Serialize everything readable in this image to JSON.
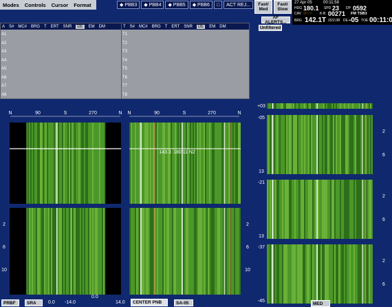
{
  "menu": [
    "Modes",
    "Controls",
    "Cursor",
    "Format"
  ],
  "pbb": [
    "PBB3",
    "PBB4",
    "PBB5",
    "PBB6"
  ],
  "pbb_extra": "ACT REJ...",
  "fast_med": "Fast/ Med",
  "fast_slow": "Fast/ Slow",
  "af_alerts": "AF ALERTS...",
  "unfiltered": "Unfiltered",
  "info": {
    "date": "27 Apr 05",
    "time1": "00:11:58",
    "hdg_label": "HDG",
    "hdg": "180.1",
    "spd_label": "SPD",
    "spd": "23",
    "dp_label": "DP",
    "dp": "0592",
    "cav_label": "CAV",
    "kb_label": "K-B",
    "kb": "00271",
    "fm": "FM TSB3",
    "brg_label": "BRG",
    "brg": "142.1T",
    "brg2": "/322.0R",
    "de_label": "DE",
    "de": "-05",
    "toe_label": "TOE",
    "toe": "00:11:02"
  },
  "table_left": {
    "headers": [
      "A",
      "S#",
      "MC#",
      "BRG",
      "T",
      "ERT",
      "SNR",
      "DE",
      "EM",
      "DM"
    ],
    "rows": [
      "A1",
      "A2",
      "A3",
      "A4",
      "A5",
      "A6",
      "A7",
      "A8"
    ]
  },
  "table_right": {
    "headers": [
      "T",
      "S#",
      "MC#",
      "BRG",
      "T",
      "ERT",
      "SNR",
      "DE",
      "EM",
      "DM"
    ],
    "rows": [
      "T1",
      "T2",
      "T3",
      "T4",
      "T5",
      "T6",
      "T7",
      "T8"
    ]
  },
  "axis_labels": [
    "N",
    "90",
    "S",
    "270",
    "N"
  ],
  "left_ticks_top": [
    "2",
    "4",
    "6",
    "8"
  ],
  "left_ticks_bot": [
    "2",
    "6",
    "10"
  ],
  "center_ticks_bot": [
    "2",
    "6",
    "10"
  ],
  "right_ticks": [
    "2",
    "6"
  ],
  "right_panel_nums": [
    "-11",
    "+03",
    "-05",
    "13",
    "-21",
    "13",
    "-37",
    "-45"
  ],
  "cursor_labels": [
    "143.3",
    "180.11 N2"
  ],
  "footer": {
    "prbf": "PRBF",
    "sra": "SRA",
    "v0": "0.0",
    "v14n": "-14.0",
    "v0b": "0.0",
    "v14": "14.0",
    "center": "CENTER PNB",
    "sa": "SA-05",
    "med": "MED"
  },
  "colors": {
    "bg": "#10286e",
    "waterfall": "#4a9a2a",
    "menu": "#c8ccd4"
  }
}
